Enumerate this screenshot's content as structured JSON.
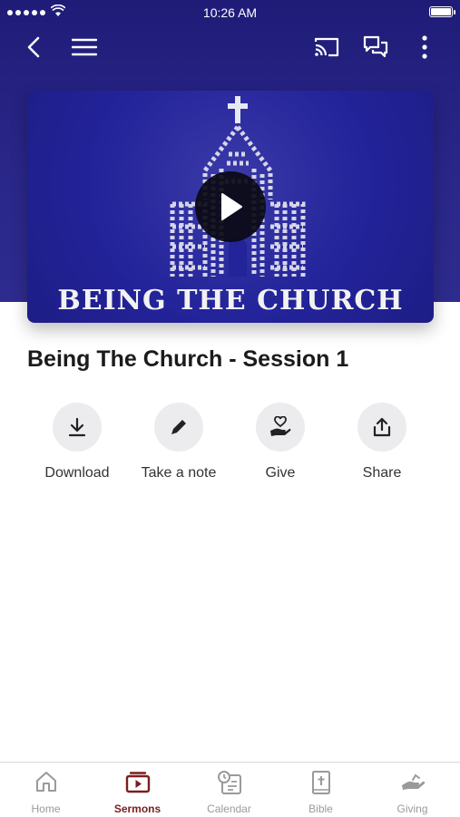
{
  "status_bar": {
    "time": "10:26 AM"
  },
  "sermon": {
    "title": "Being The Church - Session 1",
    "artwork_caption": "BEING THE CHURCH"
  },
  "actions": [
    {
      "label": "Download",
      "icon": "download-icon"
    },
    {
      "label": "Take a note",
      "icon": "pencil-icon"
    },
    {
      "label": "Give",
      "icon": "heart-hand-icon"
    },
    {
      "label": "Share",
      "icon": "share-icon"
    }
  ],
  "tabs": [
    {
      "label": "Home",
      "icon": "home-icon",
      "active": false
    },
    {
      "label": "Sermons",
      "icon": "sermons-icon",
      "active": true
    },
    {
      "label": "Calendar",
      "icon": "calendar-icon",
      "active": false
    },
    {
      "label": "Bible",
      "icon": "bible-icon",
      "active": false
    },
    {
      "label": "Giving",
      "icon": "giving-icon",
      "active": false
    }
  ],
  "colors": {
    "hero": "#26238a",
    "accent_tab": "#7a1e1e",
    "inactive_tab": "#9a9a9a"
  }
}
